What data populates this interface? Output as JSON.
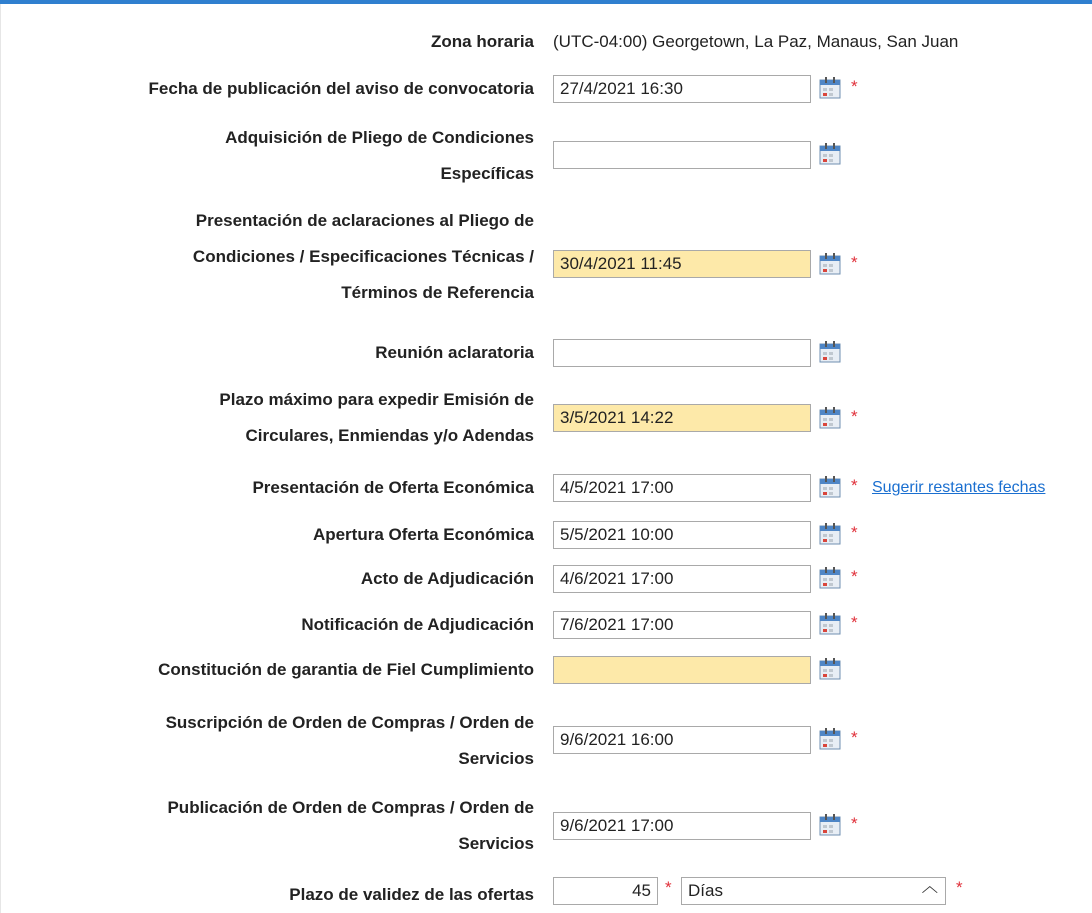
{
  "form": {
    "rows": [
      {
        "label_lines": [
          "Zona horaria"
        ],
        "value": "(UTC-04:00) Georgetown, La Paz, Manaus, San Juan"
      },
      {
        "label_lines": [
          "Fecha de publicación del aviso de convocatoria"
        ],
        "value": "27/4/2021 16:30",
        "highlight": false,
        "required": true
      },
      {
        "label_lines": [
          "Adquisición de Pliego de Condiciones",
          "Específicas"
        ],
        "value": "",
        "highlight": false,
        "required": false
      },
      {
        "label_lines": [
          "Presentación de aclaraciones al Pliego de",
          "Condiciones / Especificaciones Técnicas /",
          "Términos de Referencia"
        ],
        "value": "30/4/2021 11:45",
        "highlight": true,
        "required": true
      },
      {
        "label_lines": [
          "Reunión aclaratoria"
        ],
        "value": "",
        "highlight": false,
        "required": false
      },
      {
        "label_lines": [
          "Plazo máximo para expedir Emisión de",
          "Circulares, Enmiendas y/o Adendas"
        ],
        "value": "3/5/2021 14:22",
        "highlight": true,
        "required": true
      },
      {
        "label_lines": [
          "Presentación de Oferta Económica"
        ],
        "value": "4/5/2021 17:00",
        "highlight": false,
        "required": true,
        "link": "Sugerir restantes fechas"
      },
      {
        "label_lines": [
          "Apertura Oferta Económica"
        ],
        "value": "5/5/2021 10:00",
        "highlight": false,
        "required": true
      },
      {
        "label_lines": [
          "Acto de Adjudicación"
        ],
        "value": "4/6/2021 17:00",
        "highlight": false,
        "required": true
      },
      {
        "label_lines": [
          "Notificación de Adjudicación"
        ],
        "value": "7/6/2021 17:00",
        "highlight": false,
        "required": true
      },
      {
        "label_lines": [
          "Constitución de garantia de Fiel Cumplimiento"
        ],
        "value": "",
        "highlight": true,
        "required": false
      },
      {
        "label_lines": [
          "Suscripción de Orden de Compras / Orden de",
          "Servicios"
        ],
        "value": "9/6/2021 16:00",
        "highlight": false,
        "required": true
      },
      {
        "label_lines": [
          "Publicación de Orden de Compras / Orden de",
          "Servicios"
        ],
        "value": "9/6/2021 17:00",
        "highlight": false,
        "required": true
      }
    ],
    "validity": {
      "label": "Plazo de validez de las ofertas",
      "amount": "45",
      "unit_selected": "Días",
      "required_mark": "*"
    },
    "required_mark": "*"
  },
  "colors": {
    "header_blue": "#2f7fcf",
    "highlight_yellow": "#fde9a9",
    "required_red": "#e0303a",
    "link_blue": "#1a6fd0"
  },
  "icons": {
    "calendar": "calendar-icon",
    "dropdown": "chevron-down-icon"
  }
}
